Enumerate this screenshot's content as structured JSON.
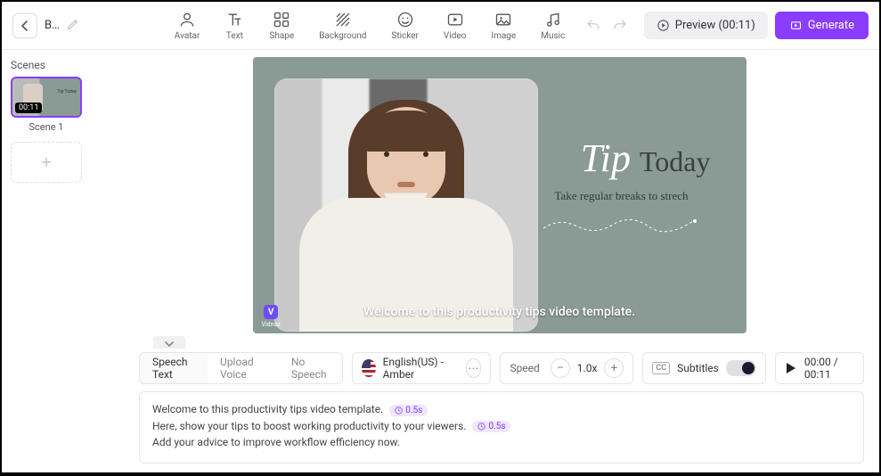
{
  "header": {
    "title": "B…",
    "tools": {
      "avatar": "Avatar",
      "text": "Text",
      "shape": "Shape",
      "background": "Background",
      "sticker": "Sticker",
      "video": "Video",
      "image": "Image",
      "music": "Music"
    },
    "preview_label": "Preview (00:11)",
    "generate_label": "Generate"
  },
  "scenes": {
    "title": "Scenes",
    "items": [
      {
        "duration": "00:11",
        "label": "Scene 1"
      }
    ]
  },
  "canvas": {
    "tip_script": "Tip",
    "tip_serif": "Today",
    "tip_sub": "Take regular breaks to strech",
    "caption": "Welcome to this productivity tips video template.",
    "brand": "Vidnoz"
  },
  "speech": {
    "tabs": {
      "speech_text": "Speech Text",
      "upload_voice": "Upload Voice",
      "no_speech": "No Speech"
    },
    "voice_name": "English(US) - Amber",
    "speed_label": "Speed",
    "speed_value": "1.0x",
    "subtitles_label": "Subtitles",
    "time": "00:00 / 00:11",
    "lines": [
      {
        "text": "Welcome to this productivity tips video template.",
        "pause": "0.5s"
      },
      {
        "text": "Here, show your tips to boost working productivity to your viewers.",
        "pause": "0.5s"
      },
      {
        "text": "Add your advice to improve workflow efficiency now.",
        "pause": null
      }
    ]
  }
}
